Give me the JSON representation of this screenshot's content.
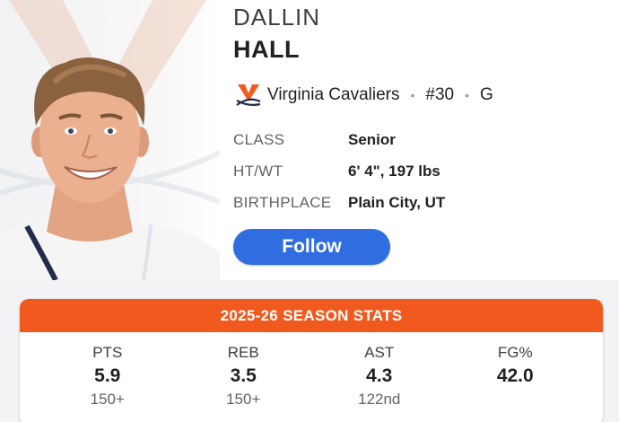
{
  "player": {
    "first_name": "DALLIN",
    "last_name": "HALL",
    "team": "Virginia Cavaliers",
    "number": "#30",
    "position": "G",
    "team_logo_icon": "cavaliers-v-sabres-logo-icon",
    "photo": "player-headshot"
  },
  "info": [
    {
      "label": "CLASS",
      "value": "Senior"
    },
    {
      "label": "HT/WT",
      "value": "6' 4\", 197 lbs"
    },
    {
      "label": "BIRTHPLACE",
      "value": "Plain City, UT"
    }
  ],
  "follow_label": "Follow",
  "stats": {
    "title": "2025-26 SEASON STATS",
    "columns": [
      {
        "label": "PTS",
        "value": "5.9",
        "rank": "150+"
      },
      {
        "label": "REB",
        "value": "3.5",
        "rank": "150+"
      },
      {
        "label": "AST",
        "value": "4.3",
        "rank": "122nd"
      },
      {
        "label": "FG%",
        "value": "42.0",
        "rank": ""
      }
    ]
  },
  "colors": {
    "team_orange": "#f05a1e",
    "team_navy": "#232d4b",
    "follow_blue": "#2f6de1"
  }
}
